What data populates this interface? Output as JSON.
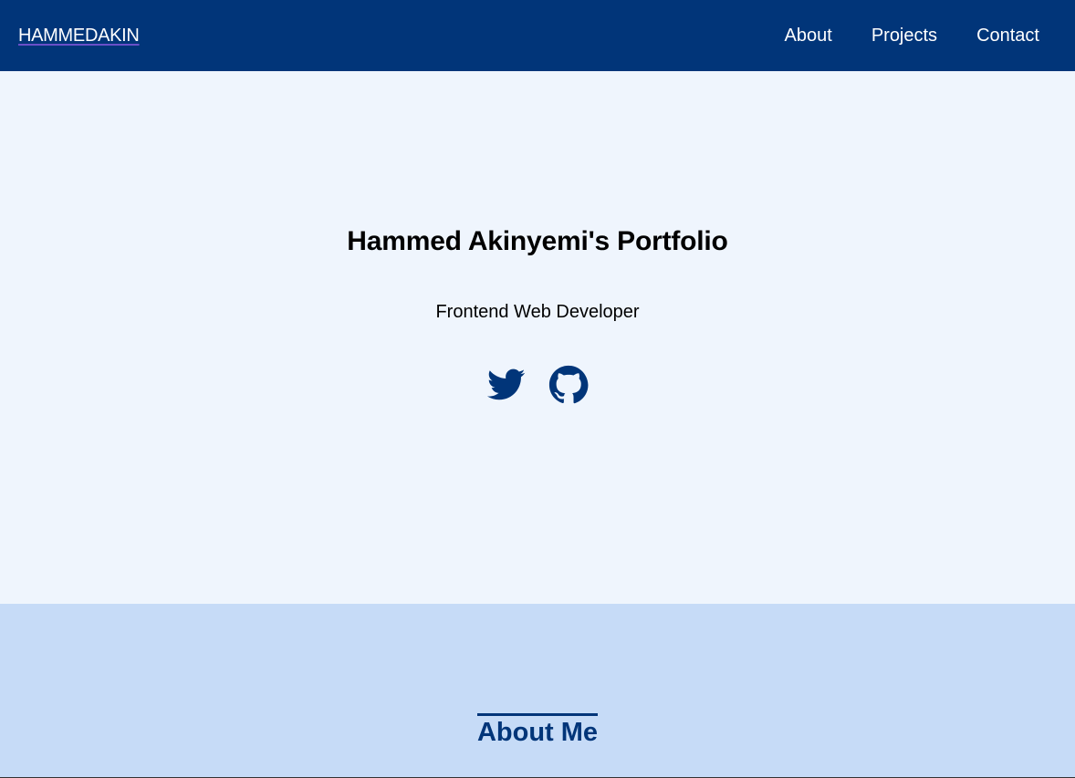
{
  "navbar": {
    "brand": "HAMMEDAKIN",
    "links": [
      "About",
      "Projects",
      "Contact"
    ]
  },
  "hero": {
    "title": "Hammed Akinyemi's Portfolio",
    "subtitle": "Frontend Web Developer",
    "social_icons": [
      "twitter-icon",
      "github-icon"
    ]
  },
  "about": {
    "heading": "About Me"
  },
  "colors": {
    "primary": "#013579",
    "hero_bg": "#eff5fd",
    "about_bg": "#c6dbf7"
  }
}
